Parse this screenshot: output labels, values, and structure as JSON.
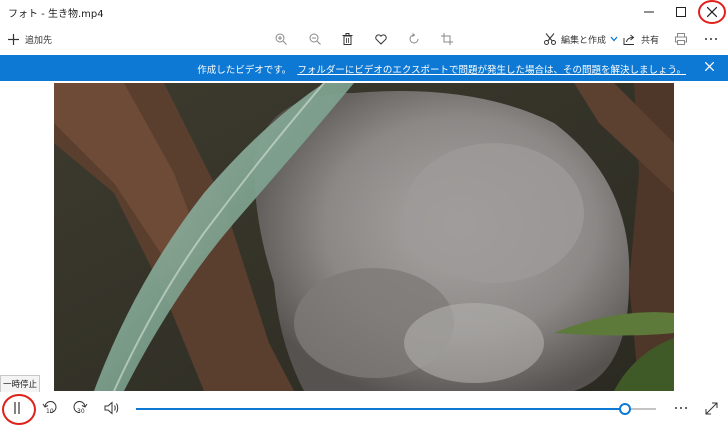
{
  "window": {
    "title": "フォト - 生き物.mp4"
  },
  "toolbar": {
    "add_label": "追加先",
    "edit_label": "編集と作成",
    "share_label": "共有",
    "icons": [
      "zoom-in-icon",
      "zoom-out-icon",
      "trash-icon",
      "heart-icon",
      "rotate-icon",
      "crop-icon",
      "print-icon"
    ]
  },
  "banner": {
    "message": "作成したビデオです。",
    "link": "フォルダーにビデオのエクスポートで問題が発生した場合は、その問題を解決しましょう。"
  },
  "player": {
    "tooltip": "一時停止",
    "rewind_label": "10",
    "forward_label": "30",
    "progress": 0.94
  },
  "colors": {
    "accent": "#0e79d4",
    "highlight": "#e0201a"
  }
}
